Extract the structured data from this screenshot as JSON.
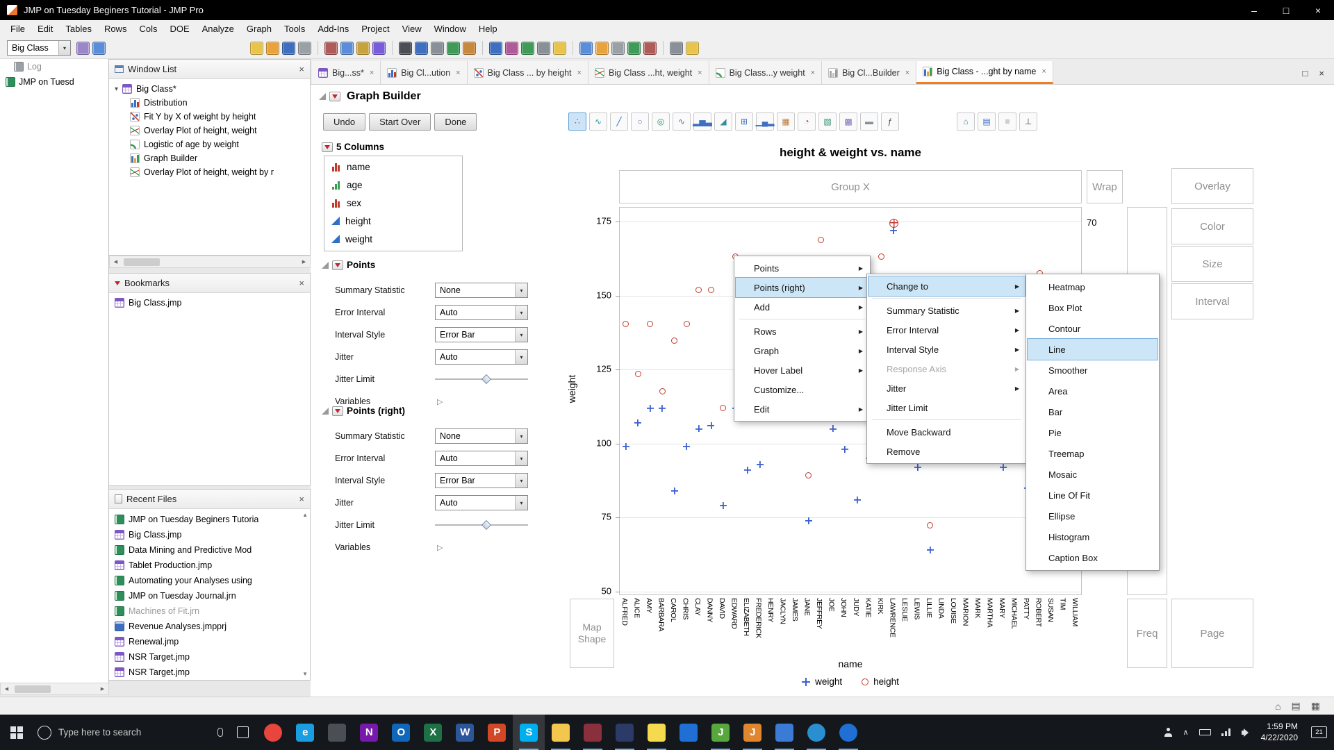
{
  "window": {
    "title": "JMP on Tuesday Beginers Tutorial - JMP Pro"
  },
  "menu_bar": [
    "File",
    "Edit",
    "Tables",
    "Rows",
    "Cols",
    "DOE",
    "Analyze",
    "Graph",
    "Tools",
    "Add-Ins",
    "Project",
    "View",
    "Window",
    "Help"
  ],
  "toolbar": {
    "context_dropdown": "Big Class",
    "icons": [
      {
        "name": "data-table-grid-icon",
        "color": "#9a86c8",
        "group": 1
      },
      {
        "name": "column-list-icon",
        "color": "#5b8dd9",
        "group": 1
      },
      {
        "name": "new-journal-icon",
        "color": "#e8c54a",
        "group": 2
      },
      {
        "name": "open-file-icon",
        "color": "#e8a33d",
        "group": 2
      },
      {
        "name": "save-icon",
        "color": "#3f6fbf",
        "group": 2
      },
      {
        "name": "print-icon",
        "color": "#9aa0a6",
        "group": 2
      },
      {
        "name": "cut-icon",
        "color": "#b05a5a",
        "group": 3
      },
      {
        "name": "copy-icon",
        "color": "#5b8dd9",
        "group": 3
      },
      {
        "name": "paste-icon",
        "color": "#c8a23d",
        "group": 3
      },
      {
        "name": "run-script-icon",
        "color": "#7a5bd9",
        "group": 3
      },
      {
        "name": "arrow-tool-icon",
        "color": "#4a4f55",
        "group": 4
      },
      {
        "name": "help-tool-icon",
        "color": "#3f6fbf",
        "group": 4
      },
      {
        "name": "magnifier-tool-icon",
        "color": "#8a9097",
        "group": 4
      },
      {
        "name": "zoom-in-tool-icon",
        "color": "#3f9b57",
        "group": 4
      },
      {
        "name": "hand-tool-icon",
        "color": "#c8883d",
        "group": 4
      },
      {
        "name": "selection-tool-icon",
        "color": "#3f6fbf",
        "group": 5
      },
      {
        "name": "lasso-tool-icon",
        "color": "#b05a9a",
        "group": 5
      },
      {
        "name": "brush-tool-icon",
        "color": "#3f9b57",
        "group": 5
      },
      {
        "name": "crosshair-tool-icon",
        "color": "#8a9097",
        "group": 5
      },
      {
        "name": "annotate-tool-icon",
        "color": "#e8c54a",
        "group": 5
      },
      {
        "name": "new-window-icon",
        "color": "#5b8dd9",
        "group": 6
      },
      {
        "name": "journal-window-icon",
        "color": "#e8a33d",
        "group": 6
      },
      {
        "name": "layout-window-icon",
        "color": "#9aa0a6",
        "group": 6
      },
      {
        "name": "script-window-icon",
        "color": "#3f9b57",
        "group": 6
      },
      {
        "name": "data-filter-icon",
        "color": "#b05a5a",
        "group": 6
      },
      {
        "name": "clipboard-icon",
        "color": "#8a9097",
        "group": 7
      },
      {
        "name": "notes-icon",
        "color": "#e8c54a",
        "group": 7
      }
    ]
  },
  "left": {
    "tree_items": [
      {
        "label": "Log",
        "icon": "log",
        "disabled": true
      },
      {
        "label": "JMP on Tuesd",
        "icon": "journal",
        "disabled": false
      }
    ],
    "window_list": {
      "title": "Window List",
      "root": "Big Class*",
      "items": [
        {
          "label": "Distribution",
          "icon": "histogram"
        },
        {
          "label": "Fit Y by X of weight by height",
          "icon": "fit"
        },
        {
          "label": "Overlay Plot of height, weight",
          "icon": "overlay"
        },
        {
          "label": "Logistic of age by weight",
          "icon": "logistic"
        },
        {
          "label": "Graph Builder",
          "icon": "gb"
        },
        {
          "label": "Overlay Plot of height, weight by r",
          "icon": "overlay"
        }
      ]
    },
    "bookmarks": {
      "title": "Bookmarks",
      "items": [
        {
          "label": "Big Class.jmp",
          "icon": "table"
        }
      ]
    },
    "recent_files": {
      "title": "Recent Files",
      "items": [
        {
          "label": "JMP on Tuesday Beginers Tutoria",
          "icon": "journal"
        },
        {
          "label": "Big Class.jmp",
          "icon": "table"
        },
        {
          "label": "Data Mining and Predictive Mod",
          "icon": "journal"
        },
        {
          "label": "Tablet Production.jmp",
          "icon": "table"
        },
        {
          "label": "Automating your Analyses using",
          "icon": "journal"
        },
        {
          "label": "JMP on Tuesday Journal.jrn",
          "icon": "journal"
        },
        {
          "label": "Machines of Fit.jrn",
          "icon": "journal",
          "disabled": true
        },
        {
          "label": "Revenue Analyses.jmpprj",
          "icon": "project"
        },
        {
          "label": "Renewal.jmp",
          "icon": "table"
        },
        {
          "label": "NSR Target.jmp",
          "icon": "table"
        },
        {
          "label": "NSR Target.jmp",
          "icon": "table"
        }
      ]
    }
  },
  "tabs": [
    {
      "label": "Big...ss*",
      "icon": "table"
    },
    {
      "label": "Big Cl...ution",
      "icon": "histogram"
    },
    {
      "label": "Big Class ... by height",
      "icon": "fit"
    },
    {
      "label": "Big Class ...ht, weight",
      "icon": "overlay"
    },
    {
      "label": "Big Class...y weight",
      "icon": "logistic"
    },
    {
      "label": "Big Cl...Builder",
      "icon": "gb-gray"
    },
    {
      "label": "Big Class - ...ght by name",
      "icon": "gb",
      "active": true
    }
  ],
  "graph_builder": {
    "title": "Graph Builder",
    "buttons": [
      "Undo",
      "Start Over",
      "Done"
    ],
    "columns_title": "5 Columns",
    "columns": [
      {
        "name": "name",
        "type": "nominal"
      },
      {
        "name": "age",
        "type": "ordinal"
      },
      {
        "name": "sex",
        "type": "nominal"
      },
      {
        "name": "height",
        "type": "continuous"
      },
      {
        "name": "weight",
        "type": "continuous"
      }
    ],
    "palette": [
      {
        "name": "points-element-icon",
        "glyph": "∴",
        "color": "#2f6fc4",
        "selected": true
      },
      {
        "name": "smoother-element-icon",
        "glyph": "∿",
        "color": "#2f8f9e"
      },
      {
        "name": "line-of-fit-element-icon",
        "glyph": "╱",
        "color": "#2f6fc4"
      },
      {
        "name": "ellipse-element-icon",
        "glyph": "○",
        "color": "#7a6fc4"
      },
      {
        "name": "contour-element-icon",
        "glyph": "◎",
        "color": "#2f8f6f"
      },
      {
        "name": "line-element-icon",
        "glyph": "∿",
        "color": "#3f6fbf"
      },
      {
        "name": "bar-element-icon",
        "glyph": "▂▅▃",
        "color": "#3f6fbf"
      },
      {
        "name": "area-element-icon",
        "glyph": "◢",
        "color": "#2f8f9e"
      },
      {
        "name": "box-plot-element-icon",
        "glyph": "⊞",
        "color": "#3f6fbf"
      },
      {
        "name": "histogram-element-icon",
        "glyph": "▁▄▂",
        "color": "#3f6fbf"
      },
      {
        "name": "heatmap-element-icon",
        "glyph": "▦",
        "color": "#c07a3d"
      },
      {
        "name": "pie-element-icon",
        "glyph": "◔",
        "color": "#c0392b"
      },
      {
        "name": "treemap-element-icon",
        "glyph": "▧",
        "color": "#2f8f6f"
      },
      {
        "name": "mosaic-element-icon",
        "glyph": "▩",
        "color": "#7a6fc4"
      },
      {
        "name": "caption-box-element-icon",
        "glyph": "▬",
        "color": "#8a9097"
      },
      {
        "name": "formula-element-icon",
        "glyph": "ƒ",
        "color": "#4a4f55"
      }
    ],
    "palette2": [
      {
        "name": "map-shape-element-icon",
        "glyph": "⌂",
        "color": "#2f8f9e"
      },
      {
        "name": "table-element-icon",
        "glyph": "▤",
        "color": "#3f6fbf"
      },
      {
        "name": "legend-element-icon",
        "glyph": "≡",
        "color": "#8a9097"
      },
      {
        "name": "axes-element-icon",
        "glyph": "⊥",
        "color": "#4a4f55"
      }
    ],
    "points_panel": {
      "title": "Points",
      "fields": [
        {
          "label": "Summary Statistic",
          "control": "select",
          "value": "None"
        },
        {
          "label": "Error Interval",
          "control": "select",
          "value": "Auto"
        },
        {
          "label": "Interval Style",
          "control": "select",
          "value": "Error Bar"
        },
        {
          "label": "Jitter",
          "control": "select",
          "value": "Auto"
        },
        {
          "label": "Jitter Limit",
          "control": "slider"
        },
        {
          "label": "Variables",
          "control": "disclosure"
        }
      ]
    },
    "points_right_panel": {
      "title": "Points (right)",
      "fields": [
        {
          "label": "Summary Statistic",
          "control": "select",
          "value": "None"
        },
        {
          "label": "Error Interval",
          "control": "select",
          "value": "Auto"
        },
        {
          "label": "Interval Style",
          "control": "select",
          "value": "Error Bar"
        },
        {
          "label": "Jitter",
          "control": "select",
          "value": "Auto"
        },
        {
          "label": "Jitter Limit",
          "control": "slider"
        },
        {
          "label": "Variables",
          "control": "disclosure"
        }
      ]
    },
    "zones": {
      "group_x": "Group X",
      "wrap": "Wrap",
      "overlay": "Overlay",
      "color": "Color",
      "size": "Size",
      "interval": "Interval",
      "map_shape": "Map Shape",
      "freq": "Freq",
      "page": "Page"
    }
  },
  "context_menus": {
    "points_menu": {
      "items": [
        {
          "label": "Points",
          "submenu": true
        },
        {
          "label": "Points (right)",
          "submenu": true,
          "highlighted": true
        },
        {
          "label": "Add",
          "submenu": true
        },
        {
          "separator": true
        },
        {
          "label": "Rows",
          "submenu": true
        },
        {
          "label": "Graph",
          "submenu": true
        },
        {
          "label": "Hover Label",
          "submenu": true
        },
        {
          "label": "Customize..."
        },
        {
          "label": "Edit",
          "submenu": true
        }
      ]
    },
    "points_right_submenu": {
      "items": [
        {
          "label": "Change to",
          "submenu": true,
          "highlighted": true
        },
        {
          "separator": true
        },
        {
          "label": "Summary Statistic",
          "submenu": true
        },
        {
          "label": "Error Interval",
          "submenu": true
        },
        {
          "label": "Interval Style",
          "submenu": true
        },
        {
          "label": "Response Axis",
          "submenu": true,
          "disabled": true
        },
        {
          "label": "Jitter",
          "submenu": true
        },
        {
          "label": "Jitter Limit"
        },
        {
          "separator": true
        },
        {
          "label": "Move Backward"
        },
        {
          "label": "Remove"
        }
      ]
    },
    "change_to_submenu": {
      "items": [
        {
          "label": "Heatmap"
        },
        {
          "label": "Box Plot"
        },
        {
          "label": "Contour"
        },
        {
          "label": "Line",
          "highlighted": true,
          "selected": true
        },
        {
          "label": "Smoother"
        },
        {
          "label": "Area"
        },
        {
          "label": "Bar"
        },
        {
          "label": "Pie"
        },
        {
          "label": "Treemap"
        },
        {
          "label": "Mosaic"
        },
        {
          "label": "Line Of Fit"
        },
        {
          "label": "Ellipse"
        },
        {
          "label": "Histogram"
        },
        {
          "label": "Caption Box"
        }
      ]
    }
  },
  "chart_data": {
    "type": "scatter",
    "title": "height & weight vs. name",
    "xlabel": "name",
    "ylabel_left": "weight",
    "ylabel_right": "height",
    "y_axis_left": {
      "min": 45,
      "max": 180,
      "ticks": [
        175,
        150,
        125,
        100,
        75,
        50
      ]
    },
    "y_axis_right": {
      "tick": 70
    },
    "grid": "horizontal",
    "legend_position": "bottom",
    "legend": [
      {
        "label": "weight",
        "marker": "plus",
        "color": "#3a5fd0"
      },
      {
        "label": "height",
        "marker": "circle",
        "color": "#c33a2c"
      }
    ],
    "categories": [
      "ALFRED",
      "ALICE",
      "AMY",
      "BARBARA",
      "CAROL",
      "CHRIS",
      "CLAY",
      "DANNY",
      "DAVID",
      "EDWARD",
      "ELIZABETH",
      "FREDERICK",
      "HENRY",
      "JACLYN",
      "JAMES",
      "JANE",
      "JEFFREY",
      "JOE",
      "JOHN",
      "JUDY",
      "KATIE",
      "KIRK",
      "LAWRENCE",
      "LESLIE",
      "LEWIS",
      "LILLIE",
      "LINDA",
      "LOUISE",
      "MARION",
      "MARK",
      "MARTHA",
      "MARY",
      "MICHAEL",
      "PATTY",
      "ROBERT",
      "SUSAN",
      "TIM",
      "WILLIAM"
    ],
    "series": [
      {
        "name": "weight",
        "axis": "left",
        "marker": "plus",
        "color": "#3a5fd0",
        "values": [
          99,
          107,
          112,
          112,
          84,
          99,
          105,
          106,
          79,
          112,
          91,
          93,
          119,
          145,
          128,
          74,
          113,
          105,
          98,
          81,
          95,
          134,
          172,
          142,
          92,
          64,
          116,
          123,
          115,
          104,
          112,
          92,
          95,
          85,
          128,
          67,
          84,
          111
        ]
      },
      {
        "name": "height",
        "axis": "right",
        "marker": "circle",
        "color": "#c33a2c",
        "values": [
          64,
          61,
          64,
          60,
          63,
          64,
          66,
          66,
          59,
          68,
          62,
          63,
          65,
          66,
          61,
          55,
          69,
          63,
          65,
          61,
          59,
          68,
          70,
          65,
          64,
          52,
          62,
          61,
          60,
          62,
          65,
          62,
          58,
          62,
          67,
          56,
          60,
          65
        ]
      }
    ],
    "selected_point": {
      "series": "height",
      "category": "LAWRENCE",
      "value": 70
    }
  },
  "status_bar": {
    "icons": [
      "home-icon",
      "arrange-windows-icon",
      "grid-view-icon"
    ]
  },
  "taskbar": {
    "search_placeholder": "Type here to search",
    "time": "1:59 PM",
    "date": "4/22/2020",
    "notification_count": "21",
    "apps": [
      {
        "name": "chrome",
        "style": "circle",
        "color": "#e8453c",
        "glyph": ""
      },
      {
        "name": "edge",
        "glyph": "e",
        "color": "#1b9de2"
      },
      {
        "name": "notepad",
        "glyph": "",
        "color": "#4a4f55"
      },
      {
        "name": "onenote",
        "glyph": "N",
        "color": "#7719aa"
      },
      {
        "name": "outlook",
        "glyph": "O",
        "color": "#1066b8"
      },
      {
        "name": "excel",
        "glyph": "X",
        "color": "#1e7145"
      },
      {
        "name": "word",
        "glyph": "W",
        "color": "#2b579a"
      },
      {
        "name": "powerpoint",
        "glyph": "P",
        "color": "#d24726"
      },
      {
        "name": "skype",
        "glyph": "S",
        "color": "#00aff0",
        "open": true,
        "active": true
      },
      {
        "name": "file-explorer",
        "glyph": "",
        "color": "#f3c64e",
        "open": true
      },
      {
        "name": "app-maroon",
        "glyph": "",
        "color": "#8a2f3c",
        "open": true
      },
      {
        "name": "app-navy",
        "glyph": "",
        "color": "#2b3a67",
        "open": true
      },
      {
        "name": "sticky-notes",
        "glyph": "",
        "color": "#f5d94e",
        "open": true
      },
      {
        "name": "photos",
        "glyph": "",
        "color": "#1f6fd4"
      },
      {
        "name": "jmp",
        "glyph": "J",
        "color": "#57a73c",
        "open": true
      },
      {
        "name": "jmp-starter",
        "glyph": "J",
        "color": "#e0862f",
        "open": true
      },
      {
        "name": "app-blue",
        "glyph": "",
        "color": "#3a7bd5",
        "open": true
      },
      {
        "name": "browser-circle",
        "style": "circle",
        "color": "#2a8fd0",
        "open": true,
        "glyph": ""
      },
      {
        "name": "teams",
        "style": "circle",
        "color": "#1f6fd4",
        "open": true,
        "glyph": ""
      }
    ]
  }
}
